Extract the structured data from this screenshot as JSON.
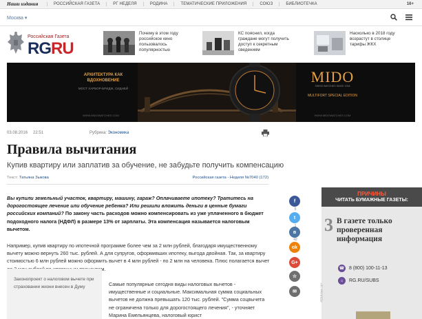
{
  "topbar": {
    "brand": "Наши издания",
    "nav": [
      "Российская газета",
      "РГ Неделя",
      "Родина",
      "Тематические приложения",
      "Союз",
      "Библиотечка"
    ],
    "age": "16+"
  },
  "city": {
    "label": "Москва"
  },
  "logo": {
    "small": "Российская Газета",
    "rg": "RG",
    "ru": "RU"
  },
  "teasers": [
    {
      "text": "Почему в этом году российское кино пользовалось популярностью"
    },
    {
      "text": "КС пояснил, когда граждане могут получить доступ к секретным сведениям"
    },
    {
      "text": "Насколько в 2018 году возрастут в столице тарифы ЖКХ"
    }
  ],
  "banner": {
    "left_title": "АРХИТЕКТУРА КАК ВДОХНОВЕНИЕ",
    "left_sub": "МОСТ ХАРБОР-БРИДЖ, СИДНЕЙ",
    "left_site": "WWW.MIDOWATCHES.COM",
    "brand": "MIDO",
    "brand_sub": "SWISS WATCHES SINCE 1918",
    "model": "MULTIFORT SPECIAL EDITION",
    "site": "WWW.MIDOWATCHES.COM"
  },
  "article": {
    "date": "03.08.2016",
    "time": "22:51",
    "rubric_label": "Рубрика:",
    "rubric": "Экономика",
    "title": "Правила вычитания",
    "subtitle": "Купив квартиру или заплатив за обучение, не забудьте получить компенсацию",
    "author_label": "Текст:",
    "author": "Татьяна Зыкова",
    "issue": "Российская газета - Неделя №7040 (172)",
    "lead_italic": "Вы купили земельный участок, квартиру, машину, гараж? Оплачиваете ипотеку? Тратитесь на дорогостоящее лечение или обучение ребенка? Или решили вложить деньги в ценные бумаги российских компаний?",
    "lead_bold": " По закону часть расходов можно компенсировать из уже уплаченного в бюджет подоходного налога (НДФЛ) в размере 13% от зарплаты. Эта компенсация называется налоговым вычетом.",
    "para1": "Например, купив квартиру по ипотечной программе более чем за 2 млн рублей, благодаря имущественному вычету можно вернуть 260 тыс. рублей. А для супругов, оформивших ипотеку, выгода двойная. Так, за квартиру стоимостью 6 млн рублей можно оформить вычет в 4 млн рублей - по 2 млн на человека. Плюс полагается вычет до 3 млн рублей по ипотечным процентам.",
    "quote": "Законопроект о налоговом вычете при страховании жизни внесен в Думу",
    "para2": "Самые популярные сегодня виды налоговых вычетов - имущественные и социальные. Максимальная сумма социальных вычетов не должна превышать 120 тыс. рублей. \"Сумма соцвычета не ограничена только для дорогостоящего лечения\", - уточняет Марина Емельянцева, налоговый юрист"
  },
  "share": {
    "buttons": [
      {
        "icon": "f",
        "color": "#3b5998"
      },
      {
        "icon": "t",
        "color": "#55acee"
      },
      {
        "icon": "в",
        "color": "#4c75a3"
      },
      {
        "icon": "ok",
        "color": "#ee8208"
      },
      {
        "icon": "G+",
        "color": "#dd4b39"
      },
      {
        "icon": "☆",
        "color": "#6f6f6f"
      },
      {
        "icon": "✉",
        "color": "#6f6f6f"
      }
    ],
    "counts": [
      "5",
      "1",
      "42"
    ]
  },
  "ad": {
    "head_red": "ПРИЧИНЫ",
    "head_white": "ЧИТАТЬ БУМАЖНЫЕ ГАЗЕТЫ:",
    "num": "3",
    "text": "В газете только проверенная информация",
    "phone": "8 (800) 100-11-13",
    "subs": "RG.RU/SUBS",
    "vertical": "РЕКЛАМА 16+"
  }
}
